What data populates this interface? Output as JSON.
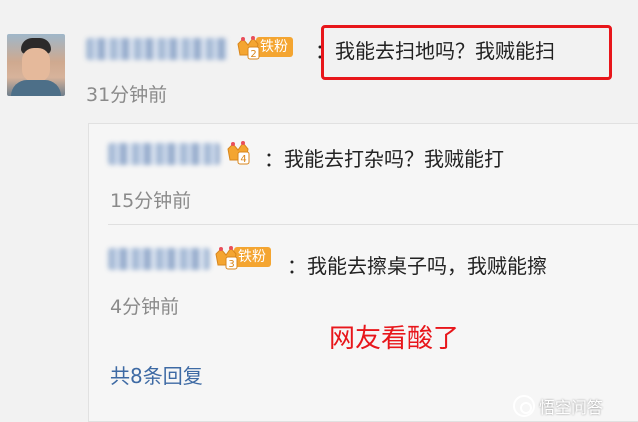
{
  "colors": {
    "background": "#f2f2f2",
    "text": "#222222",
    "time": "#8a8a8a",
    "link": "#3e6aa4",
    "badge": "#f4a531",
    "highlight": "#e8161b"
  },
  "comment": {
    "text": "：我能去扫地吗？我贼能扫",
    "time": "31分钟前",
    "badge": {
      "level": "2",
      "label": "铁粉",
      "icon": "crown-icon"
    }
  },
  "replies": [
    {
      "text": "：我能去打杂吗？我贼能打",
      "time": "15分钟前",
      "badge": {
        "level": "4",
        "icon": "crown-icon"
      }
    },
    {
      "text": "：我能去擦桌子吗，我贼能擦",
      "time": "4分钟前",
      "badge": {
        "level": "3",
        "label": "铁粉",
        "icon": "crown-icon"
      }
    }
  ],
  "more_replies": "共8条回复",
  "annotation": "网友看酸了",
  "watermark": "悟空问答"
}
